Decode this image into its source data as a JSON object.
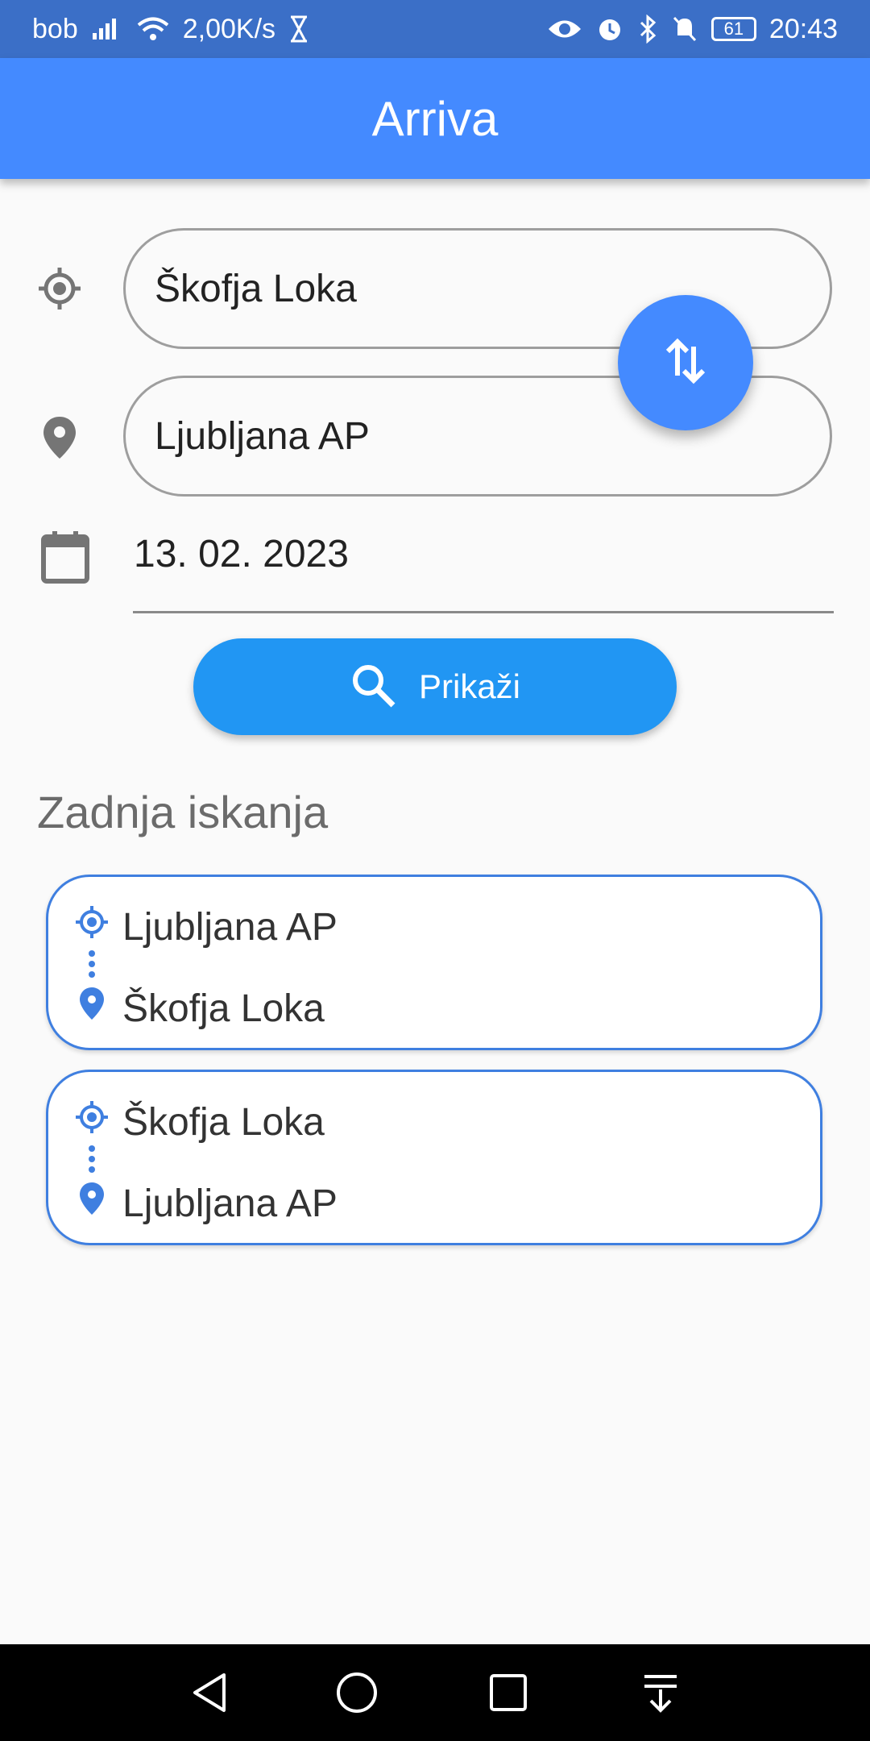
{
  "status_bar": {
    "carrier": "bob",
    "speed": "2,00K/s",
    "battery": "61",
    "time": "20:43"
  },
  "app_bar": {
    "title": "Arriva"
  },
  "form": {
    "from_value": "Škofja Loka",
    "to_value": "Ljubljana AP",
    "date_value": "13. 02. 2023",
    "search_label": "Prikaži"
  },
  "recent": {
    "title": "Zadnja iskanja",
    "items": [
      {
        "from": "Ljubljana AP",
        "to": "Škofja Loka"
      },
      {
        "from": "Škofja Loka",
        "to": "Ljubljana AP"
      }
    ]
  },
  "colors": {
    "status_bar": "#3b6fc7",
    "app_bar": "#448aff",
    "button": "#2196f3",
    "card_border": "#3f7fe0"
  },
  "icons": [
    "signal-icon",
    "wifi-icon",
    "hourglass-icon",
    "eye-icon",
    "alarm-icon",
    "bluetooth-icon",
    "mute-icon",
    "battery-icon",
    "my-location-icon",
    "place-icon",
    "calendar-icon",
    "swap-icon",
    "search-icon",
    "back-icon",
    "home-icon",
    "recents-icon",
    "notifications-pull-icon"
  ]
}
